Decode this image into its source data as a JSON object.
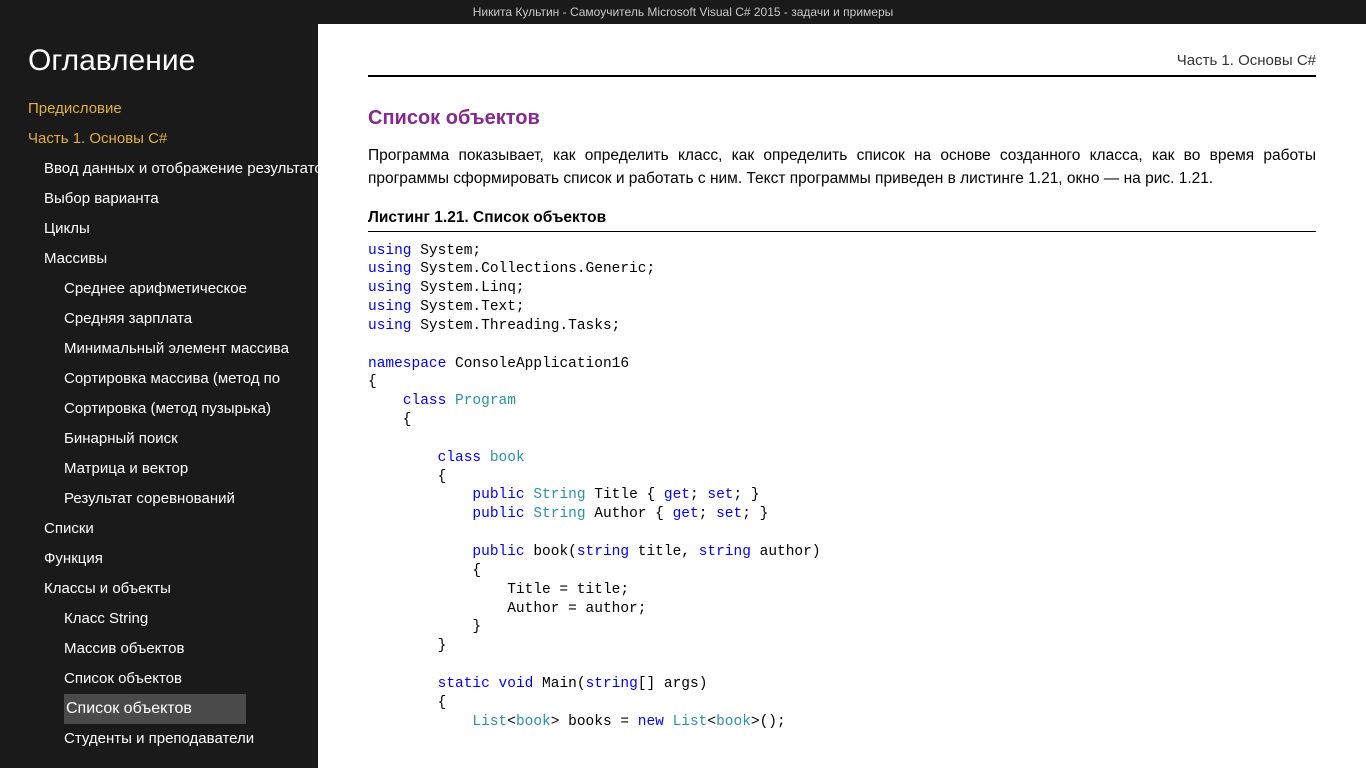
{
  "window_title": "Никита Культин - Самоучитель Microsoft Visual C# 2015 - задачи и примеры",
  "sidebar": {
    "heading": "Оглавление",
    "items": [
      {
        "label": "Предисловие",
        "level": 1,
        "selected": false
      },
      {
        "label": "Часть 1. Основы C#",
        "level": 1,
        "selected": false
      },
      {
        "label": "Ввод данных и отображение результатов",
        "level": 2,
        "selected": false
      },
      {
        "label": "Выбор варианта",
        "level": 2,
        "selected": false
      },
      {
        "label": "Циклы",
        "level": 2,
        "selected": false
      },
      {
        "label": "Массивы",
        "level": 2,
        "selected": false
      },
      {
        "label": "Среднее арифметическое",
        "level": 3,
        "selected": false
      },
      {
        "label": "Средняя зарплата",
        "level": 3,
        "selected": false
      },
      {
        "label": "Минимальный элемент массива",
        "level": 3,
        "selected": false
      },
      {
        "label": "Сортировка массива (метод по",
        "level": 3,
        "selected": false
      },
      {
        "label": "Сортировка (метод пузырька)",
        "level": 3,
        "selected": false
      },
      {
        "label": "Бинарный поиск",
        "level": 3,
        "selected": false
      },
      {
        "label": "Матрица и вектор",
        "level": 3,
        "selected": false
      },
      {
        "label": "Результат соревнований",
        "level": 3,
        "selected": false
      },
      {
        "label": "Списки",
        "level": 2,
        "selected": false
      },
      {
        "label": "Функция",
        "level": 2,
        "selected": false
      },
      {
        "label": "Классы и объекты",
        "level": 2,
        "selected": false
      },
      {
        "label": "Класс String",
        "level": 3,
        "selected": false
      },
      {
        "label": "Массив объектов",
        "level": 3,
        "selected": false
      },
      {
        "label": "Список объектов",
        "level": 3,
        "selected": false
      },
      {
        "label": "Список объектов",
        "level": 3,
        "selected": true
      },
      {
        "label": "Студенты и преподаватели",
        "level": 3,
        "selected": false
      }
    ]
  },
  "content": {
    "chapter_label": "Часть 1. Основы C#",
    "heading": "Список объектов",
    "paragraph": "Программа показывает, как определить класс, как определить список на основе созданного класса, как во время работы программы сформировать список и работать с ним. Текст программы приведен в листинге 1.21, окно — на рис. 1.21.",
    "listing_title": "Листинг 1.21. Список объектов",
    "code_tokens": [
      [
        "kw",
        "using"
      ],
      [
        "",
        " System;\n"
      ],
      [
        "kw",
        "using"
      ],
      [
        "",
        " System.Collections.Generic;\n"
      ],
      [
        "kw",
        "using"
      ],
      [
        "",
        " System.Linq;\n"
      ],
      [
        "kw",
        "using"
      ],
      [
        "",
        " System.Text;\n"
      ],
      [
        "kw",
        "using"
      ],
      [
        "",
        " System.Threading.Tasks;\n"
      ],
      [
        "",
        "\n"
      ],
      [
        "kw",
        "namespace"
      ],
      [
        "",
        " ConsoleApplication16\n{\n    "
      ],
      [
        "kw",
        "class"
      ],
      [
        "",
        " "
      ],
      [
        "typ",
        "Program"
      ],
      [
        "",
        "\n    {\n\n        "
      ],
      [
        "kw",
        "class"
      ],
      [
        "",
        " "
      ],
      [
        "typ",
        "book"
      ],
      [
        "",
        "\n        {\n            "
      ],
      [
        "kw",
        "public"
      ],
      [
        "",
        " "
      ],
      [
        "typ",
        "String"
      ],
      [
        "",
        " Title { "
      ],
      [
        "kw",
        "get"
      ],
      [
        "",
        "; "
      ],
      [
        "kw",
        "set"
      ],
      [
        "",
        "; }\n            "
      ],
      [
        "kw",
        "public"
      ],
      [
        "",
        " "
      ],
      [
        "typ",
        "String"
      ],
      [
        "",
        " Author { "
      ],
      [
        "kw",
        "get"
      ],
      [
        "",
        "; "
      ],
      [
        "kw",
        "set"
      ],
      [
        "",
        "; }\n\n            "
      ],
      [
        "kw",
        "public"
      ],
      [
        "",
        " book("
      ],
      [
        "kw",
        "string"
      ],
      [
        "",
        " title, "
      ],
      [
        "kw",
        "string"
      ],
      [
        "",
        " author)\n            {\n                Title = title;\n                Author = author;\n            }\n        }\n\n        "
      ],
      [
        "kw",
        "static"
      ],
      [
        "",
        " "
      ],
      [
        "kw",
        "void"
      ],
      [
        "",
        " Main("
      ],
      [
        "kw",
        "string"
      ],
      [
        "",
        "[] args)\n        {\n            "
      ],
      [
        "typ",
        "List"
      ],
      [
        "",
        "<"
      ],
      [
        "typ",
        "book"
      ],
      [
        "",
        "> books = "
      ],
      [
        "kw",
        "new"
      ],
      [
        "",
        " "
      ],
      [
        "typ",
        "List"
      ],
      [
        "",
        "<"
      ],
      [
        "typ",
        "book"
      ],
      [
        "",
        ">();\n"
      ]
    ]
  }
}
